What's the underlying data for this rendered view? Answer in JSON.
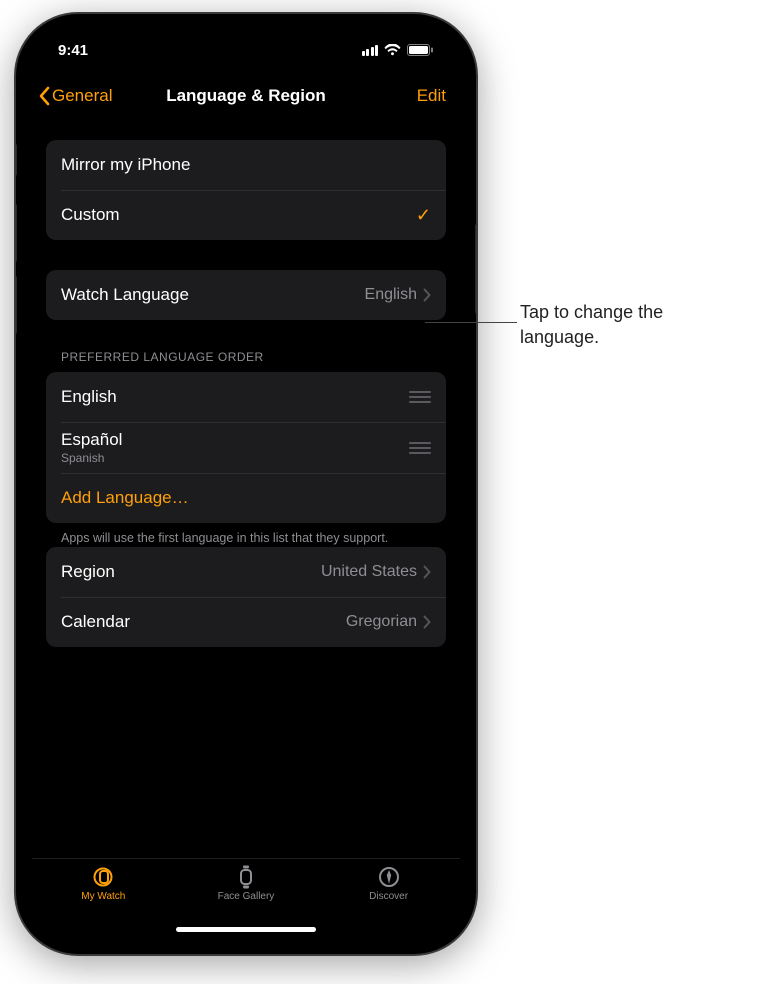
{
  "status": {
    "time": "9:41"
  },
  "nav": {
    "back_label": "General",
    "title": "Language & Region",
    "edit_label": "Edit"
  },
  "mirror_group": {
    "mirror_label": "Mirror my iPhone",
    "custom_label": "Custom",
    "selected": "Custom"
  },
  "watch_language": {
    "label": "Watch Language",
    "value": "English"
  },
  "preferred": {
    "header": "Preferred Language Order",
    "items": [
      {
        "name": "English",
        "sub": ""
      },
      {
        "name": "Español",
        "sub": "Spanish"
      }
    ],
    "add_label": "Add Language…",
    "footer": "Apps will use the first language in this list that they support."
  },
  "region_group": {
    "region_label": "Region",
    "region_value": "United States",
    "calendar_label": "Calendar",
    "calendar_value": "Gregorian"
  },
  "tabs": {
    "my_watch": "My Watch",
    "face_gallery": "Face Gallery",
    "discover": "Discover"
  },
  "callout": "Tap to change the language."
}
